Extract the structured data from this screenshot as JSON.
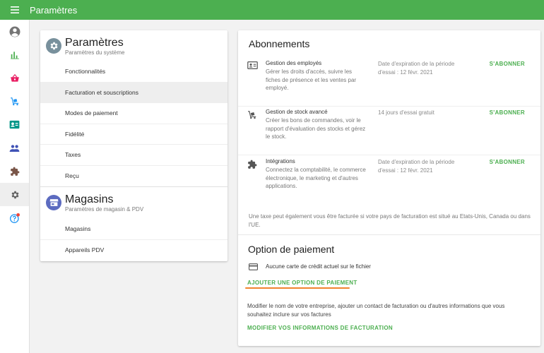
{
  "app": {
    "title": "Paramètres"
  },
  "colors": {
    "accent": "#4caf50",
    "highlight": "#f0842c"
  },
  "sidenav": {
    "items": [
      {
        "name": "account",
        "icon": "account-circle-icon"
      },
      {
        "name": "reports",
        "icon": "bar-chart-icon"
      },
      {
        "name": "sales",
        "icon": "basket-icon"
      },
      {
        "name": "inventory",
        "icon": "hand-truck-icon"
      },
      {
        "name": "employees",
        "icon": "badge-icon"
      },
      {
        "name": "customers",
        "icon": "people-icon"
      },
      {
        "name": "integrations",
        "icon": "puzzle-icon"
      },
      {
        "name": "settings",
        "icon": "gear-icon",
        "active": true
      },
      {
        "name": "help",
        "icon": "help-icon",
        "badge": true
      }
    ]
  },
  "settings_card": {
    "system": {
      "title": "Paramètres",
      "subtitle": "Paramètres du système",
      "items": [
        "Fonctionnalités",
        "Facturation et souscriptions",
        "Modes de paiement",
        "Fidélité",
        "Taxes",
        "Reçu"
      ]
    },
    "stores": {
      "title": "Magasins",
      "subtitle": "Paramètres de magasin & PDV",
      "items": [
        "Magasins",
        "Appareils PDV"
      ]
    }
  },
  "subscriptions": {
    "title": "Abonnements",
    "rows": [
      {
        "name": "Gestion des employés",
        "desc": "Gérer les droits d'accès, suivre les fiches de présence et les ventes par employé.",
        "expiry": "Date d'expiration de la période d'essai : 12 févr. 2021",
        "button": "S'ABONNER",
        "icon": "badge-icon"
      },
      {
        "name": "Gestion de stock avancé",
        "desc": "Créer les bons de commandes, voir le rapport d'évaluation des stocks et gérez le stock.",
        "expiry": "14 jours d'essai gratuit",
        "button": "S'ABONNER",
        "icon": "hand-truck-icon"
      },
      {
        "name": "Intégrations",
        "desc": "Connectez la comptabilité, le commerce électronique, le marketing et d'autres applications.",
        "expiry": "Date d'expiration de la période d'essai : 12 févr. 2021",
        "button": "S'ABONNER",
        "icon": "puzzle-icon"
      }
    ],
    "tax_note": "Une taxe peut également vous être facturée si votre pays de facturation est situé au Etats-Unis, Canada ou dans l'UE."
  },
  "payment": {
    "title": "Option de paiement",
    "no_card": "Aucune carte de crédit actuel sur le fichier",
    "add_button": "AJOUTER UNE OPTION DE PAIEMENT",
    "billing_note": "Modifier le nom de votre entreprise, ajouter un contact de facturation ou d'autres informations que vous souhaitez inclure sur vos factures",
    "billing_button": "MODIFIER VOS INFORMATIONS DE FACTURATION"
  }
}
